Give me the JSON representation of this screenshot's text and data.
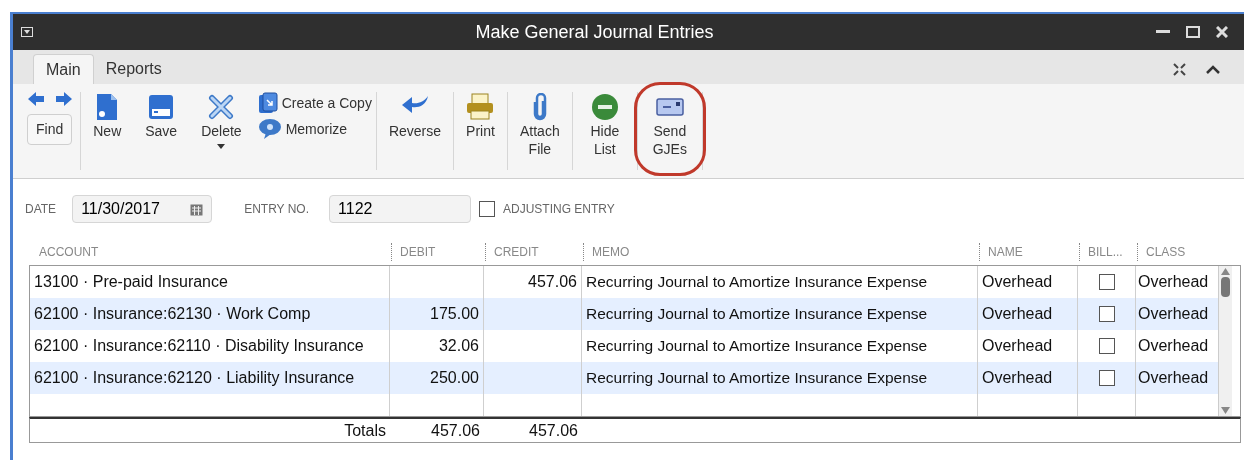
{
  "window": {
    "title": "Make General Journal Entries"
  },
  "tabs": [
    {
      "label": "Main",
      "selected": true
    },
    {
      "label": "Reports",
      "selected": false
    }
  ],
  "toolbar": [
    {
      "kind": "find",
      "label": "Find"
    },
    {
      "kind": "new",
      "label": "New"
    },
    {
      "kind": "save",
      "label": "Save"
    },
    {
      "kind": "delete",
      "label": "Delete"
    },
    {
      "kind": "pair",
      "items": [
        {
          "kind": "copy",
          "label": "Create a Copy"
        },
        {
          "kind": "memorize",
          "label": "Memorize"
        }
      ]
    },
    {
      "kind": "reverse",
      "label": "Reverse"
    },
    {
      "kind": "print",
      "label": "Print"
    },
    {
      "kind": "attach",
      "label": "Attach File"
    },
    {
      "kind": "hide",
      "label": "Hide List"
    },
    {
      "kind": "send",
      "label": "Send GJEs",
      "highlighted": true
    }
  ],
  "form": {
    "date_label": "DATE",
    "date": "11/30/2017",
    "entry_label": "ENTRY NO.",
    "entry_no": "1122",
    "adjusting_label": "ADJUSTING ENTRY",
    "adjusting": false
  },
  "table": {
    "columns": [
      "ACCOUNT",
      "DEBIT",
      "CREDIT",
      "MEMO",
      "NAME",
      "BILL...",
      "CLASS"
    ],
    "rows": [
      {
        "account": "13100 · Pre-paid Insurance",
        "debit": "",
        "credit": "457.06",
        "memo": "Recurring Journal to Amortize Insurance Expense",
        "name": "Overhead",
        "billable": false,
        "class": "Overhead"
      },
      {
        "account": "62100 · Insurance:62130 · Work Comp",
        "debit": "175.00",
        "credit": "",
        "memo": "Recurring Journal to Amortize Insurance Expense",
        "name": "Overhead",
        "billable": false,
        "class": "Overhead"
      },
      {
        "account": "62100 · Insurance:62110 · Disability Insurance",
        "debit": "32.06",
        "credit": "",
        "memo": "Recurring Journal to Amortize Insurance Expense",
        "name": "Overhead",
        "billable": false,
        "class": "Overhead"
      },
      {
        "account": "62100 · Insurance:62120 · Liability Insurance",
        "debit": "250.00",
        "credit": "",
        "memo": "Recurring Journal to Amortize Insurance Expense",
        "name": "Overhead",
        "billable": false,
        "class": "Overhead"
      }
    ],
    "totals": {
      "label": "Totals",
      "debit": "457.06",
      "credit": "457.06"
    }
  }
}
